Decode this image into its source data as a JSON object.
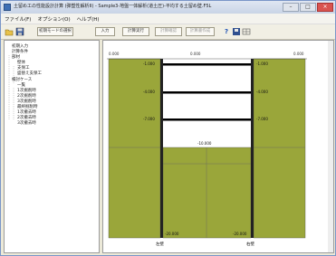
{
  "window": {
    "title": "土留め工の性能設計計算 (弾塑性解析II) - Sample3-地盤一体解析(道土圧)-平均する土留め壁.F5L",
    "min_glyph": "–",
    "max_glyph": "□",
    "close_glyph": "×"
  },
  "menu": [
    "ファイル(F)",
    "オプション(O)",
    "ヘルプ(H)"
  ],
  "toolbar": {
    "select_button": "初期モードの選択",
    "input_button": "入力",
    "calc_button": "計算実行",
    "disabled_button_1": "計算確認",
    "disabled_button_2": "計算書作成",
    "help_icon": "?"
  },
  "tree": [
    "初期入力",
    "計算条件",
    "部材",
    "壁体",
    "支保工",
    "盛替え支保工",
    "検討ケース",
    "一覧",
    "1次掘削時",
    "2次掘削時",
    "3次掘削時",
    "最終掘削時",
    "1次撤去時",
    "2次撤去時",
    "3次撤去時"
  ],
  "diagram": {
    "top_left_level": "0.000",
    "top_mid_level": "0.000",
    "top_right_level": "0.000",
    "strut_levels_left": [
      "-1.000",
      "-4.000",
      "-7.000"
    ],
    "strut_levels_right": [
      "-1.000",
      "-4.000",
      "-7.000"
    ],
    "excavation_bottom": "-10.000",
    "wall_toe_left": "-20.000",
    "wall_toe_right": "-20.000",
    "wall_name_left": "左壁",
    "wall_name_right": "右壁",
    "soil_color": "#9aa63a",
    "strut_color": "#000000"
  }
}
